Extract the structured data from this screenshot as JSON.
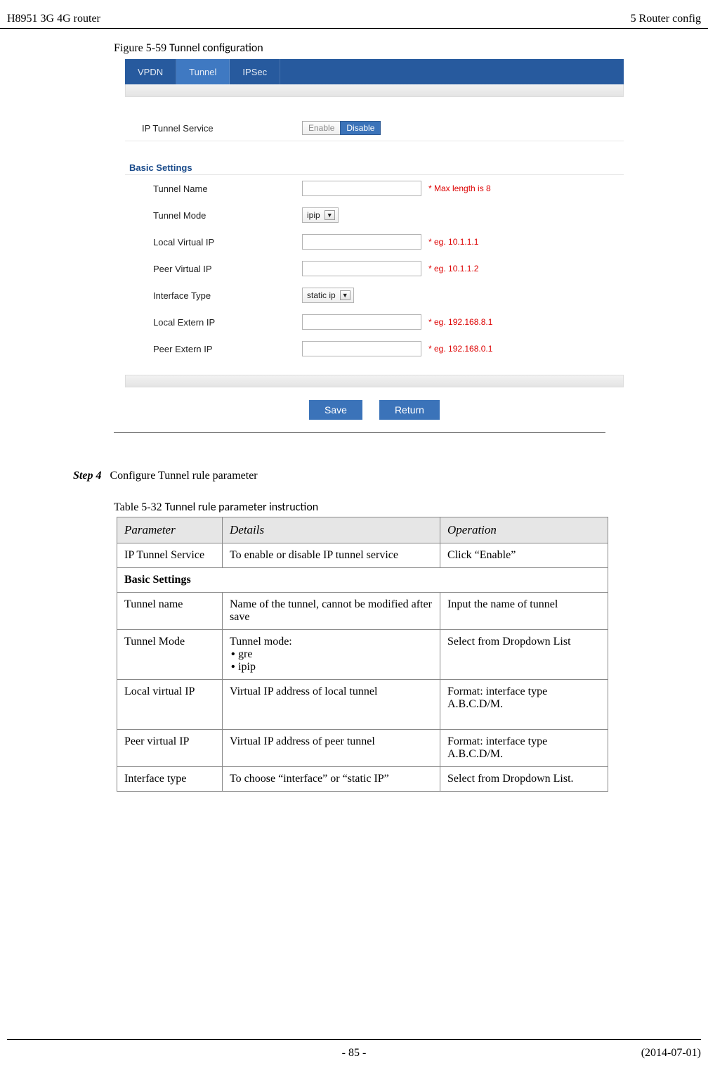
{
  "header": {
    "left": "H8951 3G 4G router",
    "right": "5  Router config"
  },
  "figure": {
    "label": "Figure 5-59 ",
    "title": "Tunnel configuration"
  },
  "screenshot": {
    "tabs": [
      "VPDN",
      "Tunnel",
      "IPSec"
    ],
    "service": {
      "label": "IP Tunnel Service",
      "enable": "Enable",
      "disable": "Disable"
    },
    "section_title": "Basic Settings",
    "rows": {
      "tunnel_name": {
        "label": "Tunnel Name",
        "hint": "* Max length is 8"
      },
      "tunnel_mode": {
        "label": "Tunnel Mode",
        "value": "ipip"
      },
      "local_virtual_ip": {
        "label": "Local Virtual IP",
        "hint": "* eg. 10.1.1.1"
      },
      "peer_virtual_ip": {
        "label": "Peer Virtual IP",
        "hint": "* eg. 10.1.1.2"
      },
      "interface_type": {
        "label": "Interface Type",
        "value": "static ip"
      },
      "local_extern_ip": {
        "label": "Local Extern IP",
        "hint": "* eg. 192.168.8.1"
      },
      "peer_extern_ip": {
        "label": "Peer Extern IP",
        "hint": "* eg. 192.168.0.1"
      }
    },
    "buttons": {
      "save": "Save",
      "return": "Return"
    }
  },
  "step": {
    "label": "Step 4",
    "text": "Configure Tunnel rule parameter"
  },
  "table_caption": {
    "label": "Table 5-32 ",
    "title": "Tunnel rule parameter instruction"
  },
  "table": {
    "headers": {
      "parameter": "Parameter",
      "details": "Details",
      "operation": "Operation"
    },
    "rows": [
      {
        "p": "IP Tunnel Service",
        "d": "To enable or disable IP tunnel service",
        "o": "Click “Enable”"
      }
    ],
    "section": "Basic Settings",
    "rows2": [
      {
        "p": "Tunnel name",
        "d": "Name of the tunnel, cannot be modified after save",
        "o": "Input the name of tunnel"
      },
      {
        "p": "Tunnel Mode",
        "d_head": "Tunnel mode:",
        "d_items": [
          "gre",
          "ipip"
        ],
        "o": "Select from Dropdown List"
      },
      {
        "p": "Local virtual IP",
        "d": "Virtual IP address of local tunnel",
        "o": "Format: interface type A.B.C.D/M."
      },
      {
        "p": "Peer virtual IP",
        "d": "Virtual IP address of peer tunnel",
        "o": "Format: interface type A.B.C.D/M."
      },
      {
        "p": "Interface type",
        "d": "To choose “interface” or “static IP”",
        "o": "Select from Dropdown List."
      }
    ]
  },
  "footer": {
    "page": "- 85 -",
    "date": "(2014-07-01)"
  }
}
